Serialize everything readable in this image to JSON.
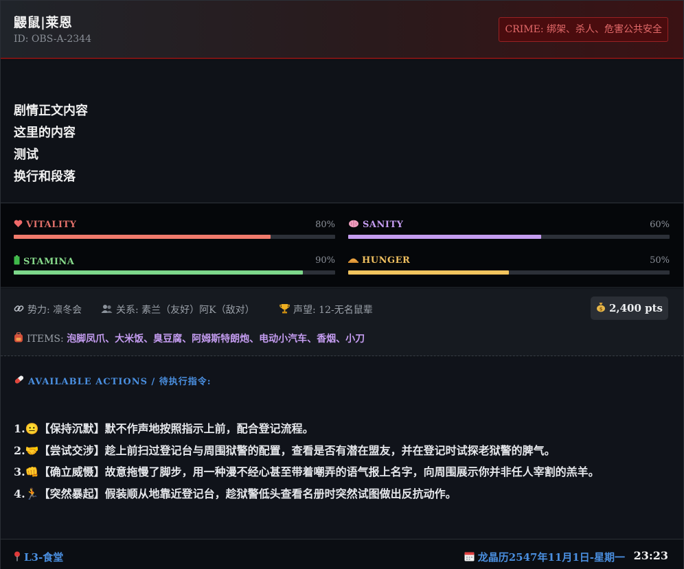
{
  "header": {
    "title": "鼹鼠|莱恩",
    "id_text": "ID: OBS-A-2344",
    "crime_badge": "CRIME: 绑架、杀人、危害公共安全"
  },
  "story": {
    "lines": [
      "剧情正文内容",
      "这里的内容",
      "测试",
      "换行和段落"
    ]
  },
  "stats": {
    "vitality": {
      "icon": "heart-icon",
      "label": "VITALITY",
      "value_text": "80%",
      "value": 80,
      "color": "#e0706a",
      "fill": "#f07a6c"
    },
    "sanity": {
      "icon": "brain-icon",
      "label": "SANITY",
      "value_text": "60%",
      "value": 60,
      "color": "#c49cf0",
      "fill": "#c49cf0"
    },
    "stamina": {
      "icon": "battery-icon",
      "label": "STAMINA",
      "value_text": "90%",
      "value": 90,
      "color": "#86d98a",
      "fill": "#7cd78a"
    },
    "hunger": {
      "icon": "food-icon",
      "label": "HUNGER",
      "value_text": "50%",
      "value": 50,
      "color": "#f0c060",
      "fill": "#f2c45e"
    }
  },
  "info": {
    "faction": "势力: 凛冬会",
    "relations": "关系: 素兰（友好）阿K（敌对）",
    "reputation": "声望: 12-无名鼠辈",
    "points": "2,400 pts",
    "items_label": "ITEMS:",
    "items_list": "泡脚凤爪、大米饭、臭豆腐、阿姆斯特朗炮、电动小汽车、香烟、小刀"
  },
  "actions": {
    "heading": "AVAILABLE ACTIONS / 待执行指令:",
    "items": [
      "1.😐【保持沉默】默不作声地按照指示上前，配合登记流程。",
      "2.🤝【尝试交涉】趁上前扫过登记台与周围狱警的配置，查看是否有潜在盟友，并在登记时试探老狱警的脾气。",
      "3.👊【确立威慑】故意拖慢了脚步，用一种漫不经心甚至带着嘲弄的语气报上名字，向周围展示你并非任人宰割的羔羊。",
      "4.🏃【突然暴起】假装顺从地靠近登记台，趁狱警低头查看名册时突然试图做出反抗动作。"
    ]
  },
  "footer": {
    "location": "L3-食堂",
    "date": "龙晶历2547年11月1日-星期一",
    "time": "23:23"
  }
}
